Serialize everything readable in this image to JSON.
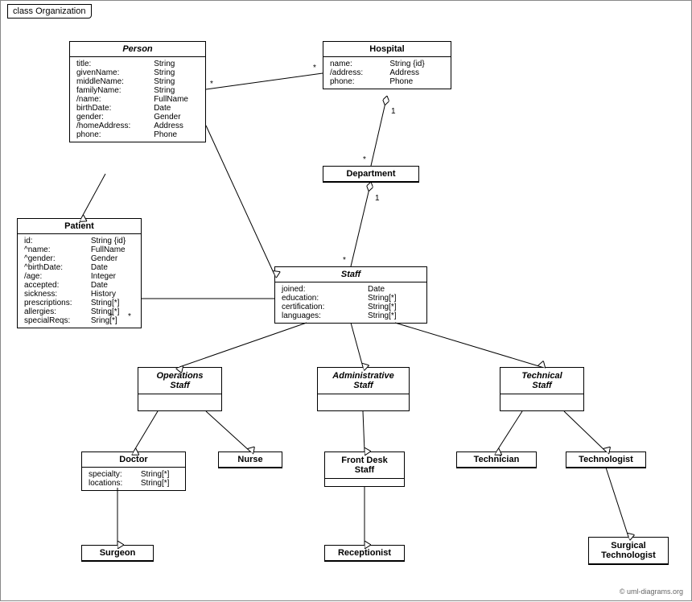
{
  "title": "class Organization",
  "copyright": "© uml-diagrams.org",
  "classes": {
    "person": {
      "name": "Person",
      "italic": true,
      "attributes": [
        [
          "title:",
          "String"
        ],
        [
          "givenName:",
          "String"
        ],
        [
          "middleName:",
          "String"
        ],
        [
          "familyName:",
          "String"
        ],
        [
          "/name:",
          "FullName"
        ],
        [
          "birthDate:",
          "Date"
        ],
        [
          "gender:",
          "Gender"
        ],
        [
          "/homeAddress:",
          "Address"
        ],
        [
          "phone:",
          "Phone"
        ]
      ]
    },
    "hospital": {
      "name": "Hospital",
      "italic": false,
      "attributes": [
        [
          "name:",
          "String {id}"
        ],
        [
          "/address:",
          "Address"
        ],
        [
          "phone:",
          "Phone"
        ]
      ]
    },
    "department": {
      "name": "Department",
      "italic": false,
      "attributes": []
    },
    "patient": {
      "name": "Patient",
      "italic": false,
      "attributes": [
        [
          "id:",
          "String {id}"
        ],
        [
          "^name:",
          "FullName"
        ],
        [
          "^gender:",
          "Gender"
        ],
        [
          "^birthDate:",
          "Date"
        ],
        [
          "/age:",
          "Integer"
        ],
        [
          "accepted:",
          "Date"
        ],
        [
          "sickness:",
          "History"
        ],
        [
          "prescriptions:",
          "String[*]"
        ],
        [
          "allergies:",
          "String[*]"
        ],
        [
          "specialReqs:",
          "Sring[*]"
        ]
      ]
    },
    "staff": {
      "name": "Staff",
      "italic": true,
      "attributes": [
        [
          "joined:",
          "Date"
        ],
        [
          "education:",
          "String[*]"
        ],
        [
          "certification:",
          "String[*]"
        ],
        [
          "languages:",
          "String[*]"
        ]
      ]
    },
    "operations_staff": {
      "name": "Operations\nStaff",
      "italic": true,
      "attributes": []
    },
    "administrative_staff": {
      "name": "Administrative\nStaff",
      "italic": true,
      "attributes": []
    },
    "technical_staff": {
      "name": "Technical\nStaff",
      "italic": true,
      "attributes": []
    },
    "doctor": {
      "name": "Doctor",
      "italic": false,
      "attributes": [
        [
          "specialty:",
          "String[*]"
        ],
        [
          "locations:",
          "String[*]"
        ]
      ]
    },
    "nurse": {
      "name": "Nurse",
      "italic": false,
      "attributes": []
    },
    "front_desk_staff": {
      "name": "Front Desk\nStaff",
      "italic": false,
      "attributes": []
    },
    "technician": {
      "name": "Technician",
      "italic": false,
      "attributes": []
    },
    "technologist": {
      "name": "Technologist",
      "italic": false,
      "attributes": []
    },
    "surgeon": {
      "name": "Surgeon",
      "italic": false,
      "attributes": []
    },
    "receptionist": {
      "name": "Receptionist",
      "italic": false,
      "attributes": []
    },
    "surgical_technologist": {
      "name": "Surgical\nTechnologist",
      "italic": false,
      "attributes": []
    }
  }
}
